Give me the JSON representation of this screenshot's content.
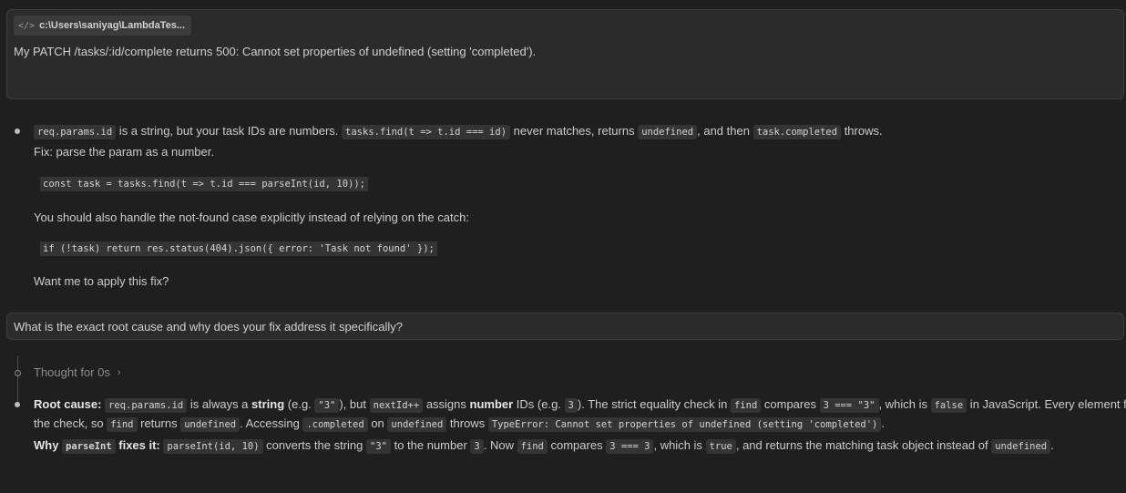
{
  "user_message_1": {
    "file_chip": "c:\\Users\\saniyag\\LambdaTes...",
    "text": "My PATCH /tasks/:id/complete returns 500: Cannot set properties of undefined (setting 'completed')."
  },
  "response_1": {
    "line1": {
      "code_a": "req.params.id",
      "t1": " is a string, but your task IDs are numbers. ",
      "code_b": "tasks.find(t => t.id === id)",
      "t2": " never matches, returns ",
      "code_c": "undefined",
      "t3": ", and then ",
      "code_d": "task.completed",
      "t4": " throws."
    },
    "line2": "Fix: parse the param as a number.",
    "code_block_1": "const task = tasks.find(t => t.id === parseInt(id, 10));",
    "line3": "You should also handle the not-found case explicitly instead of relying on the catch:",
    "code_block_2": "if (!task) return res.status(404).json({ error: 'Task not found' });",
    "line4": "Want me to apply this fix?"
  },
  "user_message_2": {
    "text": "What is the exact root cause and why does your fix address it specifically?"
  },
  "thought": {
    "label": "Thought for 0s",
    "chevron": "›"
  },
  "response_2": {
    "row1": {
      "b1": "Root cause:",
      "c1": "req.params.id",
      "t1": " is always a ",
      "b2": "string",
      "t2": " (e.g. ",
      "c2": "\"3\"",
      "t3": "), but ",
      "c3": "nextId++",
      "t4": " assigns ",
      "b3": "number",
      "t5": " IDs (e.g. ",
      "c4": "3",
      "t6": "). The strict equality check in ",
      "c5": "find",
      "t7": " compares ",
      "c6": "3 === \"3\"",
      "t8": ", which is ",
      "c7": "false",
      "t9": " in JavaScript. Every element fails"
    },
    "row2": {
      "t1": "the check, so ",
      "c1": "find",
      "t2": " returns ",
      "c2": "undefined",
      "t3": ". Accessing ",
      "c3": ".completed",
      "t4": " on ",
      "c4": "undefined",
      "t5": " throws ",
      "c5": "TypeError: Cannot set properties of undefined (setting 'completed')",
      "t6": "."
    },
    "row3": {
      "b1": "Why ",
      "c1": "parseInt",
      "b2": " fixes it:",
      "t0": " ",
      "c2": "parseInt(id, 10)",
      "t1": " converts the string ",
      "c3": "\"3\"",
      "t2": " to the number ",
      "c4": "3",
      "t3": ". Now ",
      "c5": "find",
      "t4": " compares ",
      "c6": "3 === 3",
      "t5": ", which is ",
      "c7": "true",
      "t6": ", and returns the matching task object instead of ",
      "c8": "undefined",
      "t7": "."
    }
  }
}
